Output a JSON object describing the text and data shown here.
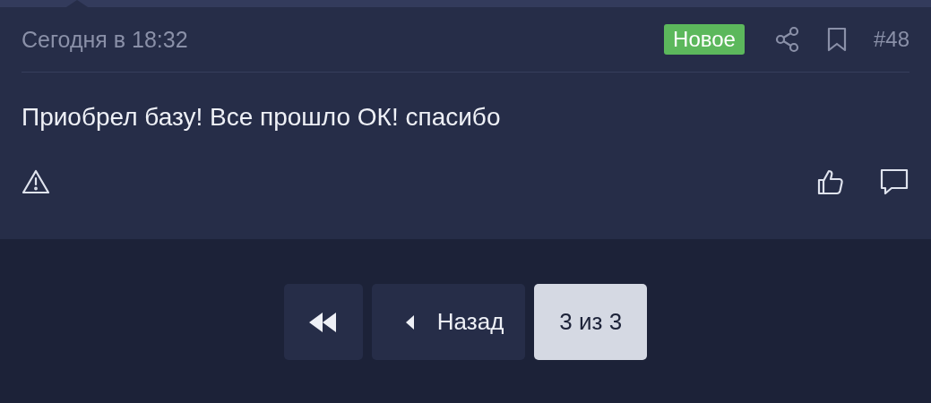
{
  "post": {
    "time": "Сегодня в 18:32",
    "badge": "Новое",
    "number": "#48",
    "text": "Приобрел базу! Все прошло ОК! спасибо"
  },
  "pagination": [
    {
      "kind": "first",
      "selected": false
    },
    {
      "kind": "prev",
      "label": "Назад",
      "selected": false
    },
    {
      "kind": "page",
      "label": "3 из 3",
      "selected": true
    }
  ]
}
